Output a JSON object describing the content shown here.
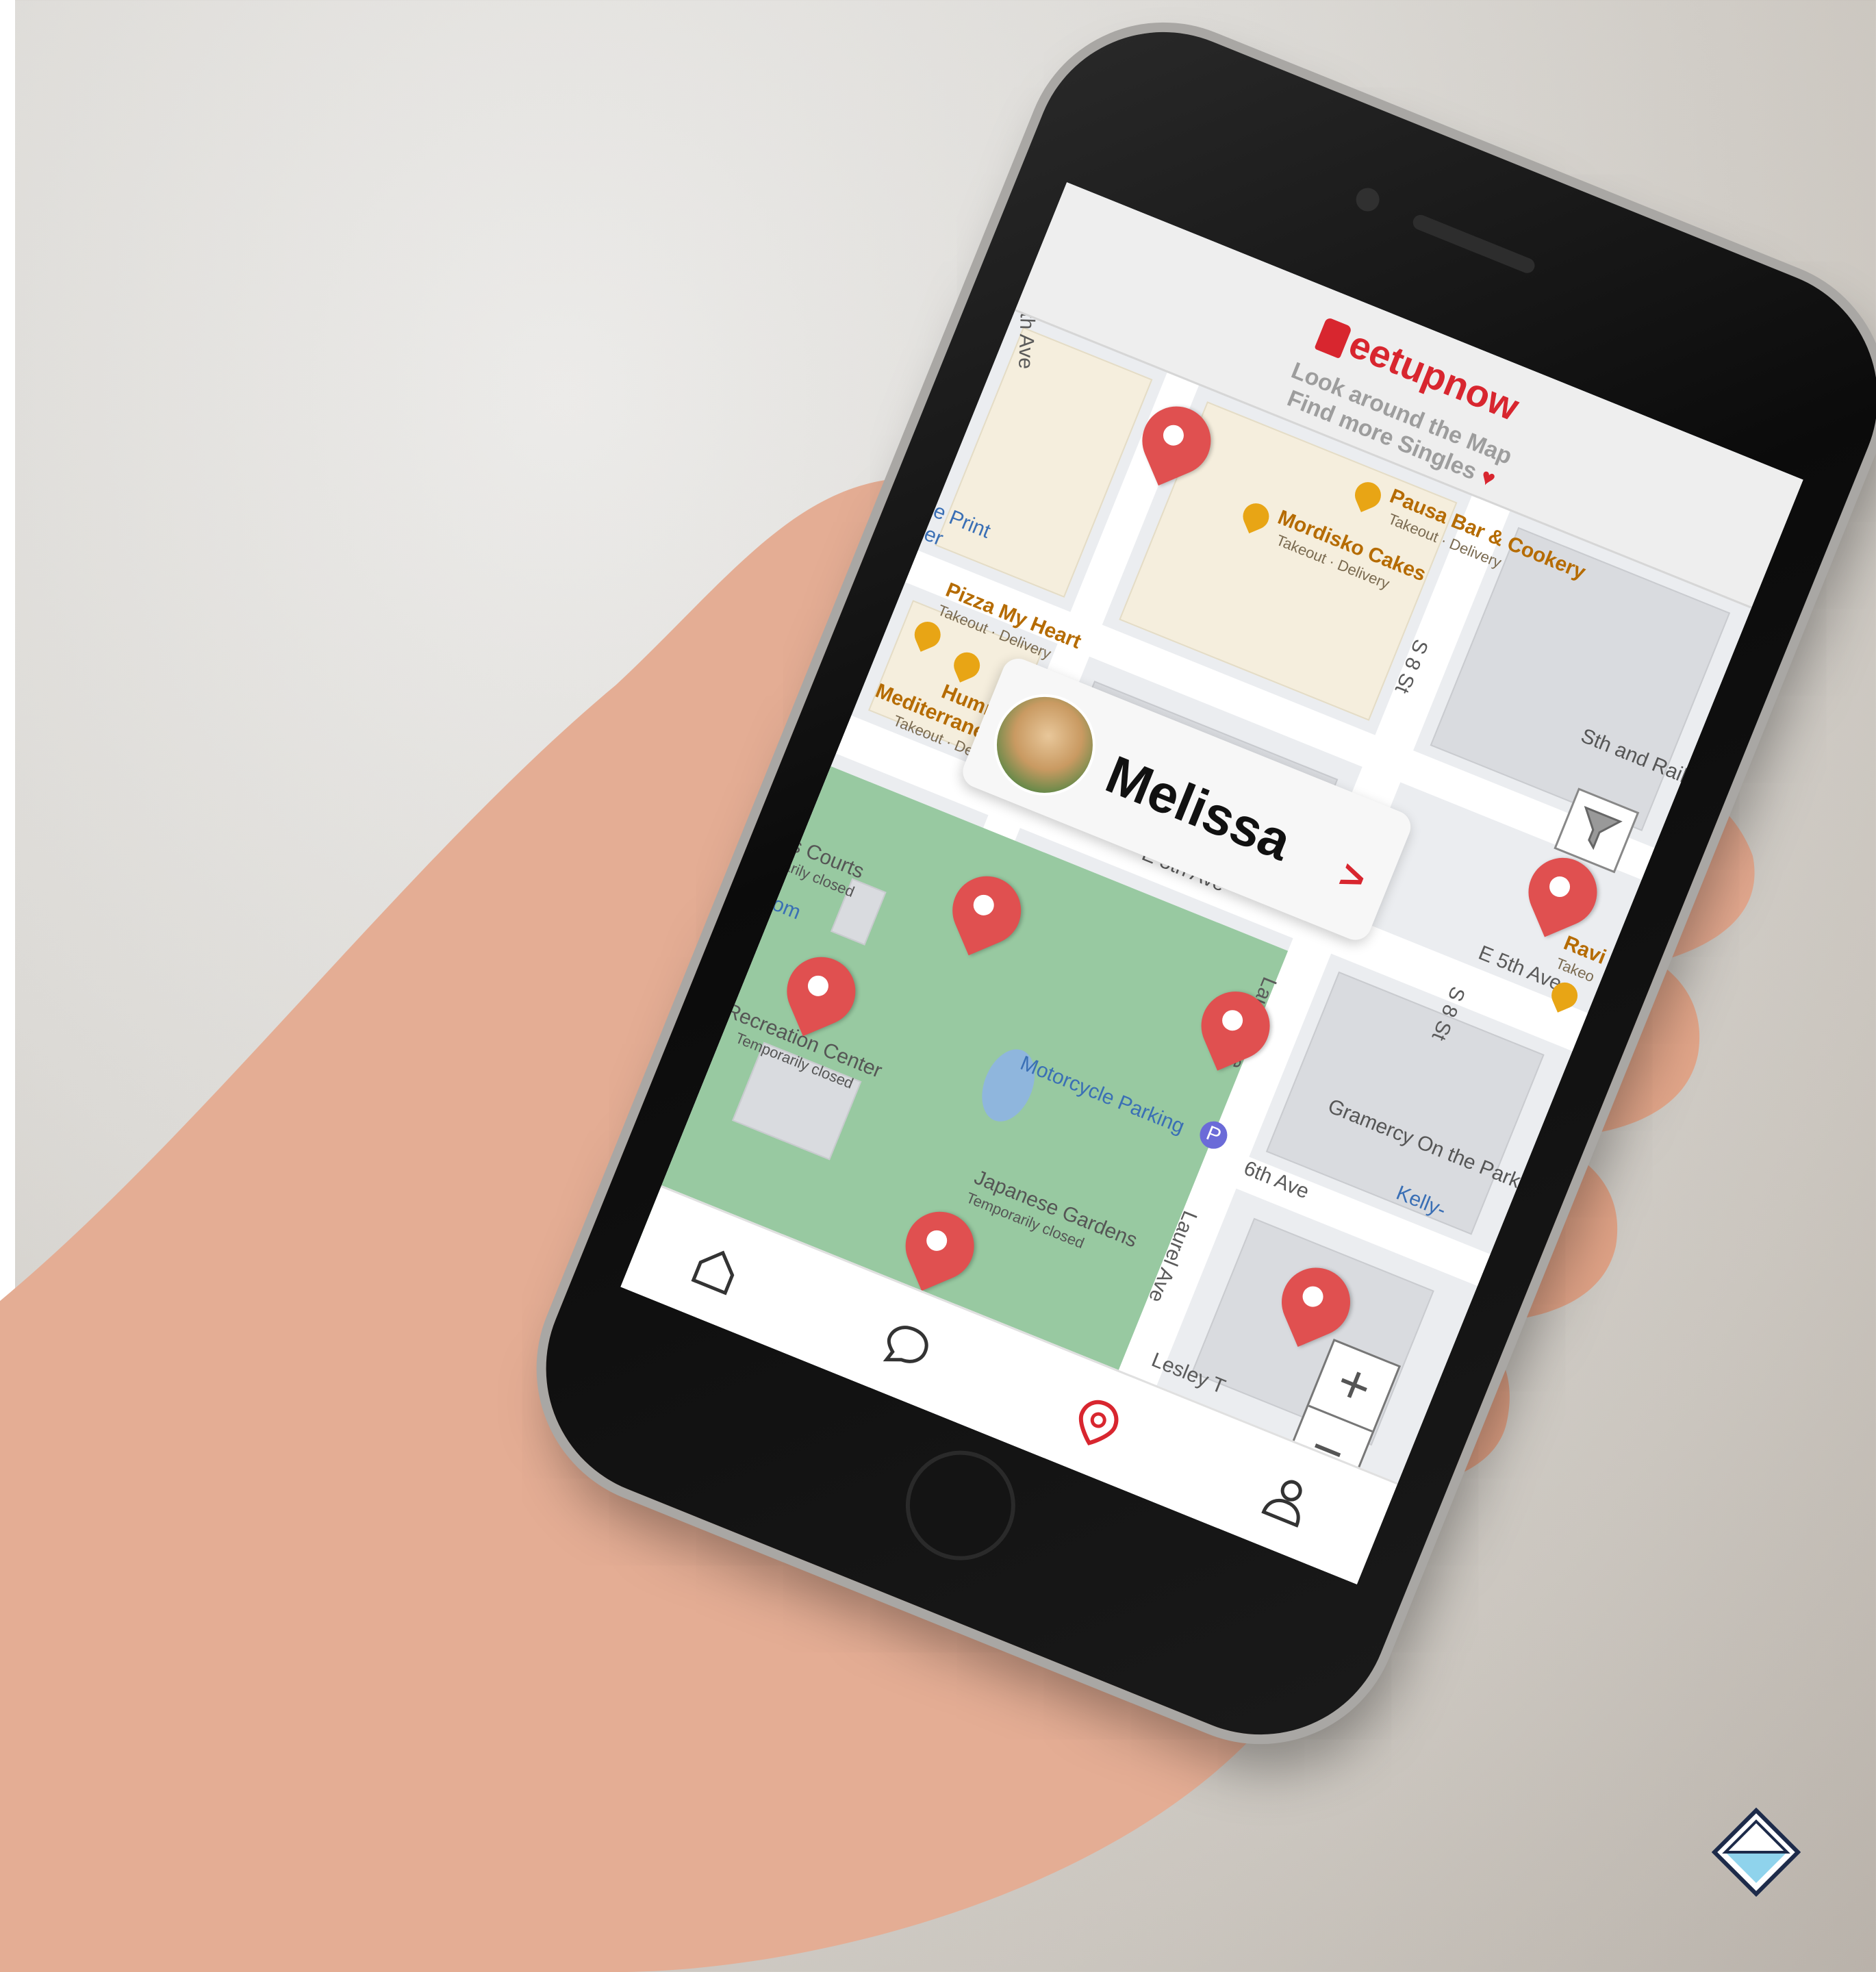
{
  "app": {
    "name": "Meetupnow",
    "logo_text": "eetupnow",
    "tagline_line1": "Look around the Map",
    "tagline_line2": "Find more Singles",
    "brand_color": "#d8262f"
  },
  "profile_card": {
    "name": "Melissa",
    "chevron": ">"
  },
  "map": {
    "streets": [
      "th Ave",
      "S 8 St",
      "E 5th Ave",
      "E 5th Ave",
      "S 8 St",
      "Laurel Ave",
      "6th Ave",
      "Laurel Ave",
      "Kelly-",
      "Lesley T"
    ],
    "places": [
      {
        "name": "Pausa Bar & Cookery",
        "sub": "Takeout · Delivery"
      },
      {
        "name": "Mordisko Cakes",
        "sub": "Takeout · Delivery"
      },
      {
        "name": "Pizza My Heart",
        "sub": "Takeout · Delivery"
      },
      {
        "name": "Hummus",
        "sub": ""
      },
      {
        "name": "Mediterranean Kitchen",
        "sub": "Takeout · Delivery"
      },
      {
        "name": "Ravi",
        "sub": "Takeo"
      },
      {
        "name": "e Print",
        "sub": "er"
      },
      {
        "name": "Gramercy On the Park",
        "sub": ""
      },
      {
        "name": "Motorcycle Parking",
        "sub": ""
      },
      {
        "name": "s Courts",
        "sub": "arily closed"
      },
      {
        "name": "ral Recreation Center",
        "sub": "Temporarily closed"
      },
      {
        "name": "Japanese Gardens",
        "sub": "Temporarily closed"
      },
      {
        "name": "Sth and Rail",
        "sub": ""
      },
      {
        "name": "oom",
        "sub": ""
      }
    ],
    "zoom_in": "+",
    "zoom_out": "−"
  },
  "nav": {
    "items": [
      "home-icon",
      "chat-icon",
      "map-pin-icon",
      "profile-icon"
    ],
    "active": "map-pin-icon"
  },
  "colors": {
    "pin": "#e05050",
    "park": "#98c9a1",
    "poi": "#e8a515"
  }
}
